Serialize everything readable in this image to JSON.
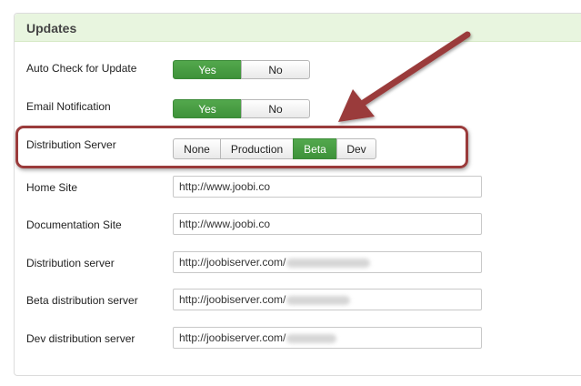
{
  "panel": {
    "title": "Updates"
  },
  "settings": {
    "auto_check": {
      "label": "Auto Check for Update",
      "yes": "Yes",
      "no": "No",
      "selected": "Yes"
    },
    "email_notification": {
      "label": "Email Notification",
      "yes": "Yes",
      "no": "No",
      "selected": "Yes"
    },
    "distribution_server": {
      "label": "Distribution Server",
      "options": [
        "None",
        "Production",
        "Beta",
        "Dev"
      ],
      "selected": "Beta"
    }
  },
  "fields": [
    {
      "label": "Home Site",
      "value": "http://www.joobi.co"
    },
    {
      "label": "Documentation Site",
      "value": "http://www.joobi.co"
    },
    {
      "label": "Distribution server",
      "value": "http://joobiserver.com/"
    },
    {
      "label": "Beta distribution server",
      "value": "http://joobiserver.com/"
    },
    {
      "label": "Dev distribution server",
      "value": "http://joobiserver.com/"
    }
  ],
  "colors": {
    "header_bg": "#e8f5df",
    "active_button": "#47a042",
    "annotation": "#9a3b3b"
  },
  "annotation": {
    "type": "arrow-and-rounded-box",
    "icon": "annotation-arrow-icon"
  }
}
